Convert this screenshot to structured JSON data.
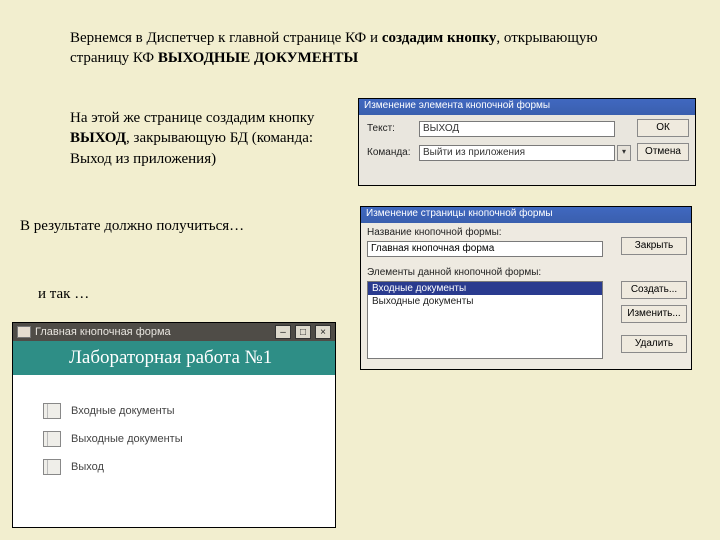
{
  "para1_a": "Вернемся в Диспетчер к главной странице КФ и ",
  "para1_b": "создадим кнопку",
  "para1_c": ", открывающую страницу КФ ",
  "para1_d": "ВЫХОДНЫЕ ДОКУМЕНТЫ",
  "para2_a": "На этой же странице создадим кнопку ",
  "para2_b": "ВЫХОД",
  "para2_c": ", закрывающую БД (команда: Выход из приложения)",
  "para3": "В результате должно получиться…",
  "para4": "и так …",
  "dlg1": {
    "title": "Изменение элемента кнопочной формы",
    "lbl_text": "Текст:",
    "lbl_cmd": "Команда:",
    "val_text": "ВЫХОД",
    "val_cmd": "Выйти из приложения",
    "ok": "ОК",
    "cancel": "Отмена"
  },
  "dlg2": {
    "title": "Изменение страницы кнопочной формы",
    "lbl_name": "Название кнопочной формы:",
    "val_name": "Главная кнопочная форма",
    "lbl_items": "Элементы данной кнопочной формы:",
    "items": {
      "0": "Входные документы",
      "1": "Выходные документы"
    },
    "btn_close": "Закрыть",
    "btn_create": "Создать...",
    "btn_change": "Изменить...",
    "btn_delete": "Удалить"
  },
  "win3": {
    "title": "Главная кнопочная форма",
    "header": "Лабораторная работа №1",
    "items": {
      "0": "Входные документы",
      "1": "Выходные документы",
      "2": "Выход"
    }
  }
}
